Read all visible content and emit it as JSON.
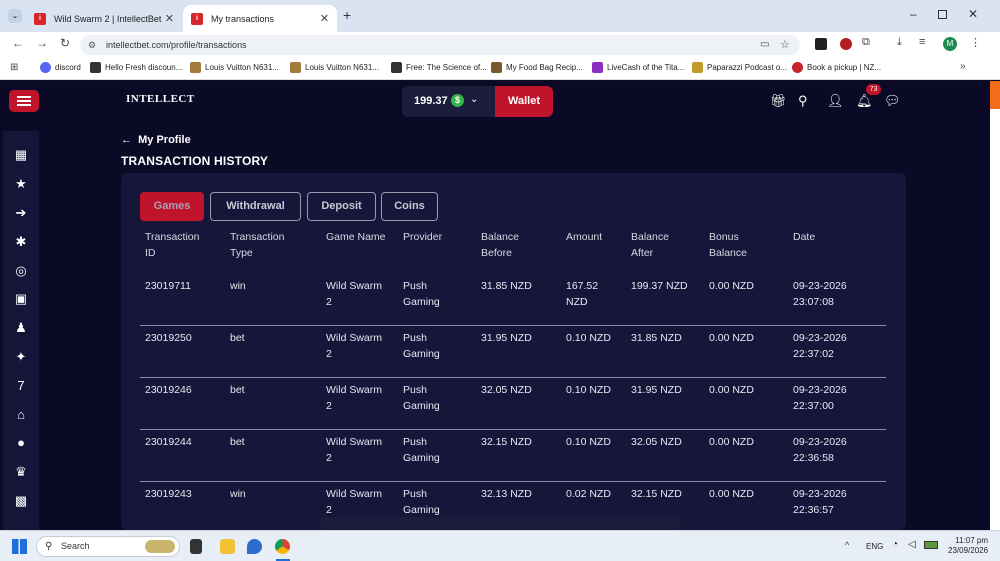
{
  "browser": {
    "tabs": [
      {
        "title": "Wild Swarm 2 | IntellectBet",
        "active": false
      },
      {
        "title": "My transactions",
        "active": true
      }
    ],
    "url": "intellectbet.com/profile/transactions",
    "bookmarks": [
      "discord",
      "Hello Fresh discoun...",
      "Louis Vuitton N631...",
      "Louis Vuitton N631...",
      "Free: The Science of...",
      "My Food Bag Recip...",
      "LiveCash of the Tita...",
      "Paparazzi Podcast o...",
      "Book a pickup | NZ..."
    ],
    "profile_initial": "M"
  },
  "header": {
    "logo": "INTELLECT",
    "balance": "199.37",
    "currency_icon": "$",
    "wallet_label": "Wallet",
    "notification_count": "73"
  },
  "page": {
    "back_label": "My Profile",
    "title": "TRANSACTION HISTORY"
  },
  "filters": [
    {
      "label": "Games",
      "active": true
    },
    {
      "label": "Withdrawal",
      "active": false
    },
    {
      "label": "Deposit",
      "active": false
    },
    {
      "label": "Coins",
      "active": false
    }
  ],
  "table": {
    "columns": [
      [
        "Transaction",
        "ID"
      ],
      [
        "Transaction",
        "Type"
      ],
      [
        "Game Name",
        ""
      ],
      [
        "Provider",
        ""
      ],
      [
        "Balance",
        "Before"
      ],
      [
        "Amount",
        ""
      ],
      [
        "Balance",
        "After"
      ],
      [
        "Bonus",
        "Balance"
      ],
      [
        "Date",
        ""
      ]
    ],
    "rows": [
      [
        [
          "23019711"
        ],
        [
          "win"
        ],
        [
          "Wild Swarm",
          "2"
        ],
        [
          "Push",
          "Gaming"
        ],
        [
          "31.85 NZD"
        ],
        [
          "167.52",
          "NZD"
        ],
        [
          "199.37 NZD"
        ],
        [
          "0.00 NZD"
        ],
        [
          "09-23-2026",
          "23:07:08"
        ]
      ],
      [
        [
          "23019250"
        ],
        [
          "bet"
        ],
        [
          "Wild Swarm",
          "2"
        ],
        [
          "Push",
          "Gaming"
        ],
        [
          "31.95 NZD"
        ],
        [
          "0.10 NZD"
        ],
        [
          "31.85 NZD"
        ],
        [
          "0.00 NZD"
        ],
        [
          "09-23-2026",
          "22:37:02"
        ]
      ],
      [
        [
          "23019246"
        ],
        [
          "bet"
        ],
        [
          "Wild Swarm",
          "2"
        ],
        [
          "Push",
          "Gaming"
        ],
        [
          "32.05 NZD"
        ],
        [
          "0.10 NZD"
        ],
        [
          "31.95 NZD"
        ],
        [
          "0.00 NZD"
        ],
        [
          "09-23-2026",
          "22:37:00"
        ]
      ],
      [
        [
          "23019244"
        ],
        [
          "bet"
        ],
        [
          "Wild Swarm",
          "2"
        ],
        [
          "Push",
          "Gaming"
        ],
        [
          "32.15 NZD"
        ],
        [
          "0.10 NZD"
        ],
        [
          "32.05 NZD"
        ],
        [
          "0.00 NZD"
        ],
        [
          "09-23-2026",
          "22:36:58"
        ]
      ],
      [
        [
          "23019243"
        ],
        [
          "win"
        ],
        [
          "Wild Swarm",
          "2"
        ],
        [
          "Push",
          "Gaming"
        ],
        [
          "32.13 NZD"
        ],
        [
          "0.02 NZD"
        ],
        [
          "32.15 NZD"
        ],
        [
          "0.00 NZD"
        ],
        [
          "09-23-2026",
          "22:36:57"
        ]
      ]
    ]
  },
  "taskbar": {
    "search_placeholder": "Search",
    "language": "ENG",
    "time": "11:07 pm",
    "date": "23/09/2026"
  },
  "colors": {
    "accent": "#c0142a",
    "background": "#0a0a26",
    "panel": "#15163a"
  }
}
